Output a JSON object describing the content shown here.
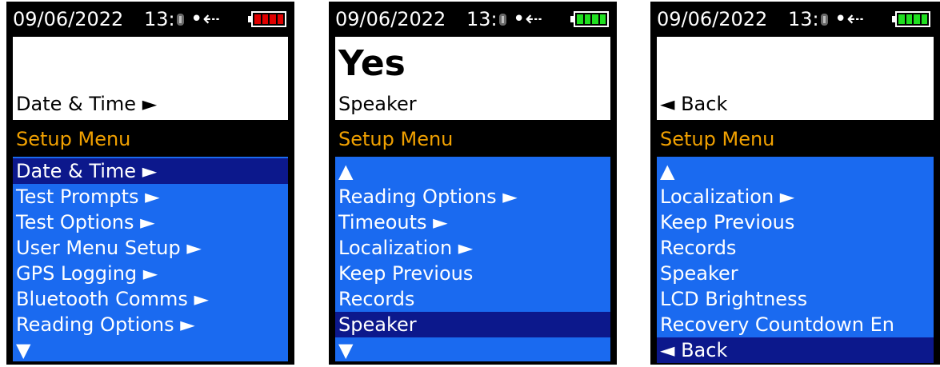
{
  "colors": {
    "list_bg": "#1a6af0",
    "selected_bg": "#0c188c",
    "header_text": "#f0a000",
    "battery_low": "#e00000",
    "battery_full": "#20e020"
  },
  "screens": [
    {
      "status": {
        "date": "09/06/2022",
        "time": "13:",
        "bluetooth_icon": "bluetooth-icon",
        "usb_icon": "usb-icon",
        "battery": "low"
      },
      "title_big": "",
      "title_sub": "Date & Time ►",
      "menu_header": "Setup Menu",
      "items": [
        {
          "label": "Date & Time ►",
          "selected": true
        },
        {
          "label": "Test Prompts ►",
          "selected": false
        },
        {
          "label": "Test Options ►",
          "selected": false
        },
        {
          "label": "User Menu Setup ►",
          "selected": false
        },
        {
          "label": "GPS Logging ►",
          "selected": false
        },
        {
          "label": "Bluetooth Comms ►",
          "selected": false
        },
        {
          "label": "Reading Options ►",
          "selected": false
        },
        {
          "label": "▼",
          "selected": false
        }
      ]
    },
    {
      "status": {
        "date": "09/06/2022",
        "time": "13:",
        "bluetooth_icon": "bluetooth-icon",
        "usb_icon": "usb-icon",
        "battery": "full"
      },
      "title_big": "Yes",
      "title_sub": "Speaker",
      "menu_header": "Setup Menu",
      "items": [
        {
          "label": "▲",
          "selected": false
        },
        {
          "label": "Reading Options ►",
          "selected": false
        },
        {
          "label": "Timeouts ►",
          "selected": false
        },
        {
          "label": "Localization ►",
          "selected": false
        },
        {
          "label": "Keep Previous",
          "selected": false
        },
        {
          "label": "Records",
          "selected": false
        },
        {
          "label": "Speaker",
          "selected": true
        },
        {
          "label": "▼",
          "selected": false
        }
      ]
    },
    {
      "status": {
        "date": "09/06/2022",
        "time": "13:",
        "bluetooth_icon": "bluetooth-icon",
        "usb_icon": "usb-icon",
        "battery": "full"
      },
      "title_big": "",
      "title_sub": "◄ Back",
      "menu_header": "Setup Menu",
      "items": [
        {
          "label": "▲",
          "selected": false
        },
        {
          "label": "Localization ►",
          "selected": false
        },
        {
          "label": "Keep Previous",
          "selected": false
        },
        {
          "label": "Records",
          "selected": false
        },
        {
          "label": "Speaker",
          "selected": false
        },
        {
          "label": "LCD Brightness",
          "selected": false
        },
        {
          "label": "Recovery Countdown En",
          "selected": false
        },
        {
          "label": "◄ Back",
          "selected": true
        }
      ]
    }
  ]
}
